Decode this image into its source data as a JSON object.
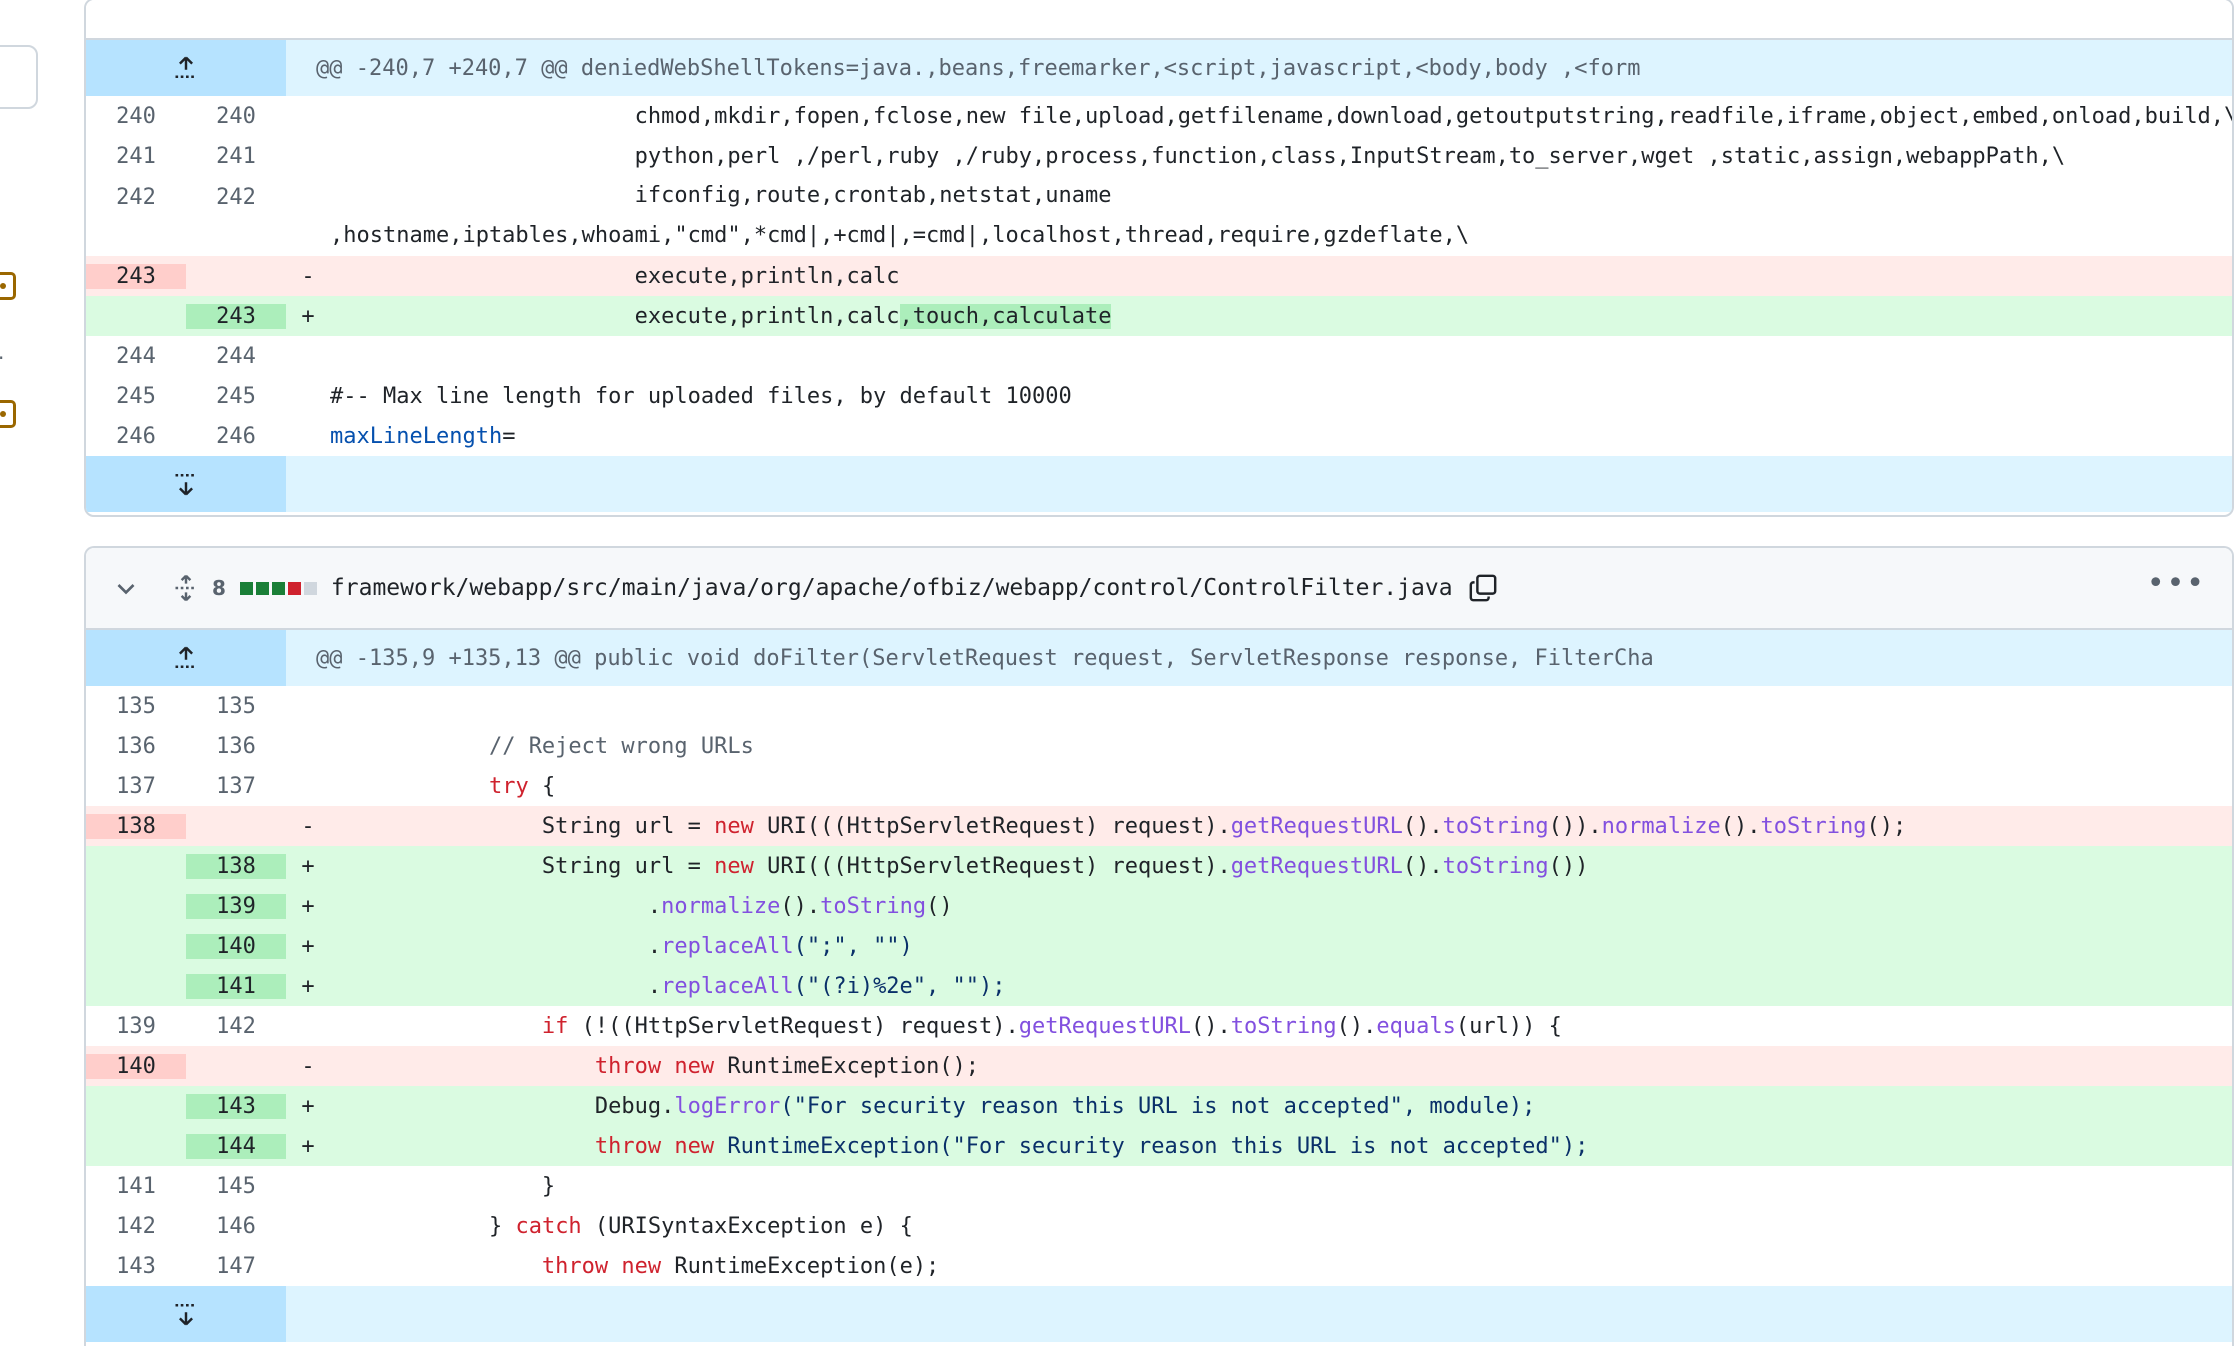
{
  "file1": {
    "hunk": "@@ -240,7 +240,7 @@ deniedWebShellTokens=java.,beans,freemarker,<script,javascript,<body,body ,<form",
    "lines": [
      {
        "old": "240",
        "new": "240",
        "type": "ctx",
        "sign": "",
        "code": "                       chmod,mkdir,fopen,fclose,new file,upload,getfilename,download,getoutputstring,readfile,iframe,object,embed,onload,build,\\"
      },
      {
        "old": "241",
        "new": "241",
        "type": "ctx",
        "sign": "",
        "code": "                       python,perl ,/perl,ruby ,/ruby,process,function,class,InputStream,to_server,wget ,static,assign,webappPath,\\"
      },
      {
        "old": "242",
        "new": "242",
        "type": "ctx",
        "sign": "",
        "code": "                       ifconfig,route,crontab,netstat,uname",
        "code2": ",hostname,iptables,whoami,\"cmd\",*cmd|,+cmd|,=cmd|,localhost,thread,require,gzdeflate,\\"
      },
      {
        "old": "243",
        "new": "",
        "type": "del",
        "sign": "-",
        "code": "                       execute,println,calc"
      },
      {
        "old": "",
        "new": "243",
        "type": "add",
        "sign": "+",
        "code": "                       execute,println,calc",
        "hl": ",touch,calculate"
      },
      {
        "old": "244",
        "new": "244",
        "type": "ctx",
        "sign": "",
        "code": ""
      },
      {
        "old": "245",
        "new": "245",
        "type": "ctx",
        "sign": "",
        "code": "#-- Max line length for uploaded files, by default 10000"
      },
      {
        "old": "246",
        "new": "246",
        "type": "ctx",
        "sign": "",
        "code": "maxLineLength="
      }
    ]
  },
  "file2": {
    "change_count": "8",
    "filename": "framework/webapp/src/main/java/org/apache/ofbiz/webapp/control/ControlFilter.java",
    "hunk": "@@ -135,9 +135,13 @@ public void doFilter(ServletRequest request, ServletResponse response, FilterCha",
    "lines": [
      {
        "old": "135",
        "new": "135",
        "sign": ""
      },
      {
        "old": "136",
        "new": "136",
        "sign": ""
      },
      {
        "old": "137",
        "new": "137",
        "sign": ""
      },
      {
        "old": "138",
        "new": "",
        "sign": "-"
      },
      {
        "old": "",
        "new": "138",
        "sign": "+"
      },
      {
        "old": "",
        "new": "139",
        "sign": "+"
      },
      {
        "old": "",
        "new": "140",
        "sign": "+"
      },
      {
        "old": "",
        "new": "141",
        "sign": "+"
      },
      {
        "old": "139",
        "new": "142",
        "sign": ""
      },
      {
        "old": "140",
        "new": "",
        "sign": "-"
      },
      {
        "old": "",
        "new": "143",
        "sign": "+"
      },
      {
        "old": "",
        "new": "144",
        "sign": "+"
      },
      {
        "old": "141",
        "new": "145",
        "sign": ""
      },
      {
        "old": "142",
        "new": "146",
        "sign": ""
      },
      {
        "old": "143",
        "new": "147",
        "sign": ""
      }
    ],
    "code": {
      "l1_comment": "// Reject wrong URLs",
      "l2_try": "try",
      "l2_brace": " {",
      "l3_a": "String url = ",
      "l3_new": "new",
      "l3_b": " URI(((HttpServletRequest) request).",
      "l3_getRequestURL": "getRequestURL",
      "l3_c": "().",
      "l3_toString": "toString",
      "l3_d": "()).",
      "l3_normalize": "normalize",
      "l3_e": "().",
      "l3_toString2": "toString",
      "l3_f": "();",
      "l4_d": "())",
      "l5_a": ".",
      "l5_normalize": "normalize",
      "l5_b": "().",
      "l5_toString": "toString",
      "l5_c": "()",
      "l6_a": ".",
      "l6_replaceAll": "replaceAll",
      "l6_b": "(\";\", \"\")",
      "l7_a": ".",
      "l7_replaceAll": "replaceAll",
      "l7_b": "(\"(?i)%2e\", \"\");",
      "l8_if": "if",
      "l8_a": " (!((HttpServletRequest) request).",
      "l8_getRequestURL": "getRequestURL",
      "l8_b": "().",
      "l8_toString": "toString",
      "l8_c": "().",
      "l8_equals": "equals",
      "l8_d": "(url)) {",
      "l9_throw": "throw",
      "l9_new": "new",
      "l9_a": " RuntimeException();",
      "l10_a": "Debug.",
      "l10_logError": "logError",
      "l10_b": "(\"For security reason this URL is not accepted\", module);",
      "l11_throw": "throw",
      "l11_new": "new",
      "l11_a": " RuntimeException(\"For security reason this URL is not accepted\");",
      "l12": "}",
      "l13_a": "} ",
      "l13_catch": "catch",
      "l13_b": " (URISyntaxException e) {",
      "l14_throw": "throw",
      "l14_new": "new",
      "l14_a": " RuntimeException(e);"
    }
  }
}
